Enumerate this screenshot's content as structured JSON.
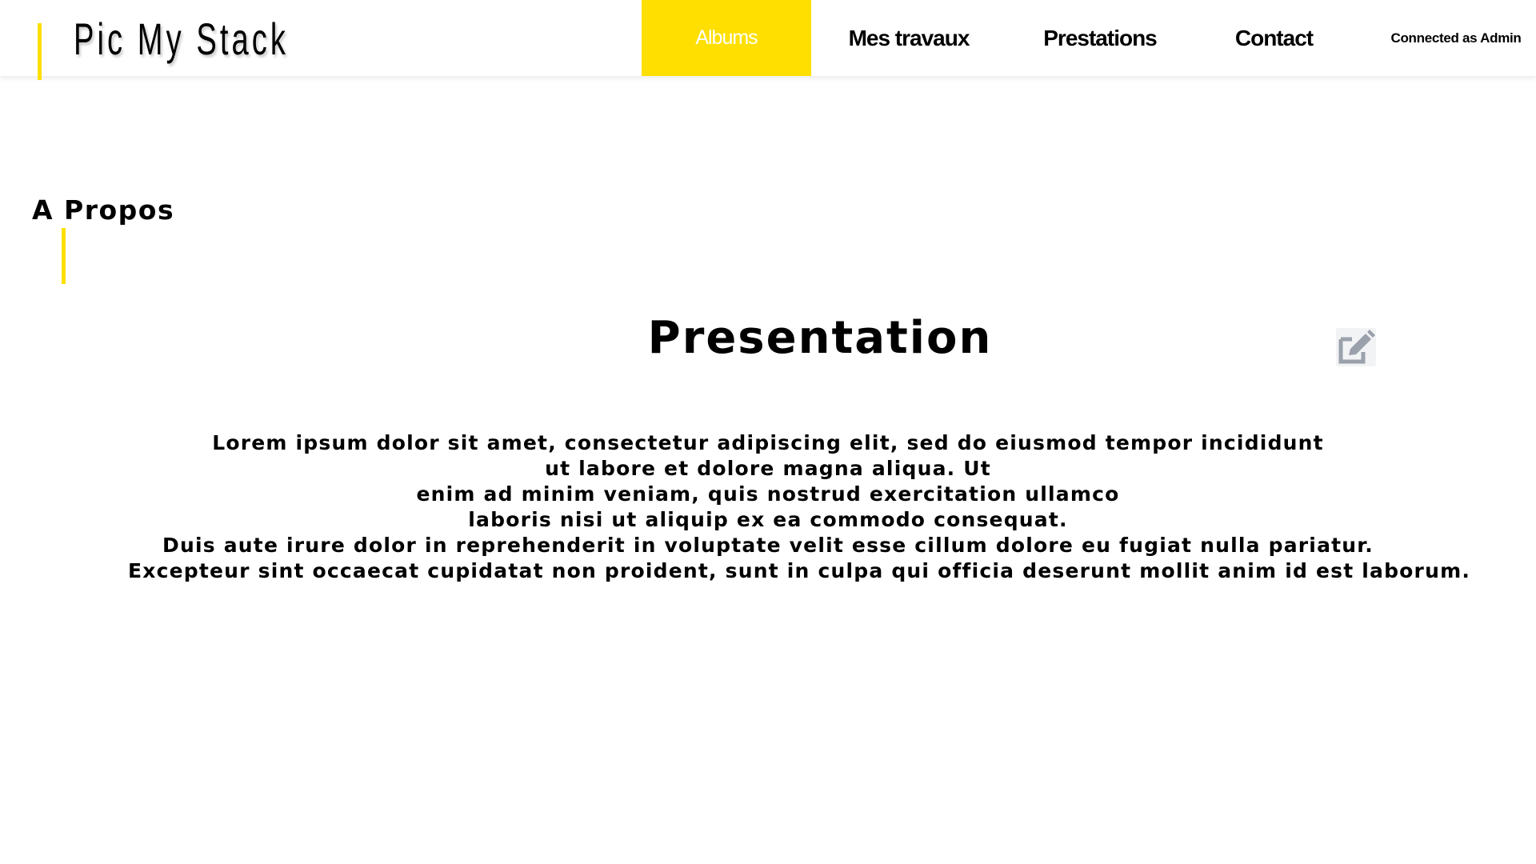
{
  "header": {
    "logo_text": "Pic My Stack",
    "nav": [
      {
        "label": "Albums",
        "active": true
      },
      {
        "label": "Mes travaux",
        "active": false
      },
      {
        "label": "Prestations",
        "active": false
      },
      {
        "label": "Contact",
        "active": false
      }
    ],
    "user_status": "Connected as Admin"
  },
  "section": {
    "title": "A Propos"
  },
  "presentation": {
    "title": "Presentation",
    "edit_icon": "edit-icon",
    "lines": [
      "Lorem ipsum dolor sit amet, consectetur adipiscing elit, sed do eiusmod tempor incididunt",
      "ut labore et dolore magna aliqua. Ut",
      "enim ad minim veniam, quis nostrud exercitation ullamco",
      "laboris nisi ut aliquip ex ea commodo consequat.",
      "Duis aute irure dolor in reprehenderit in voluptate velit esse cillum dolore eu fugiat nulla pariatur.",
      "Excepteur sint occaecat cupidatat non proident, sunt in culpa qui officia deserunt mollit anim id est laborum."
    ]
  },
  "colors": {
    "accent": "#ffdf00",
    "text": "#000000",
    "background": "#ffffff",
    "icon": "#9aa1ab"
  }
}
